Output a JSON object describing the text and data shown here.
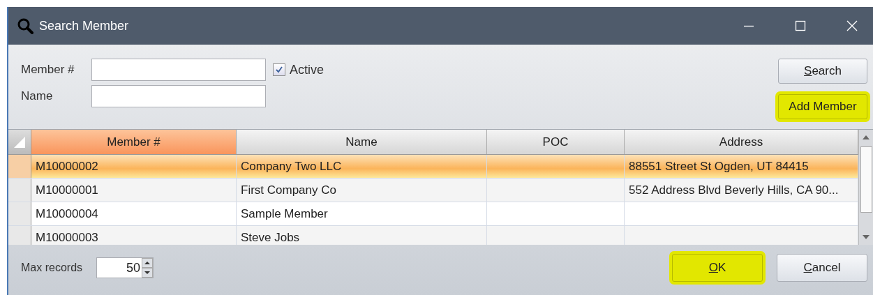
{
  "window": {
    "title": "Search Member"
  },
  "filters": {
    "member_label": "Member #",
    "name_label": "Name",
    "active": {
      "label": "Active",
      "checked": true
    }
  },
  "side_buttons": [
    {
      "label": "Search",
      "mnemonic": true,
      "highlighted": false
    },
    {
      "label": "Add Member",
      "mnemonic": false,
      "highlighted": true
    }
  ],
  "table": {
    "columns": [
      {
        "label": "Member #",
        "sorted": true
      },
      {
        "label": "Name",
        "sorted": false
      },
      {
        "label": "POC",
        "sorted": false
      },
      {
        "label": "Address",
        "sorted": false
      }
    ],
    "rows": [
      {
        "cells": [
          "M10000002",
          "Company Two LLC",
          "",
          "88551 Street St Ogden, UT 84415"
        ],
        "selected": true
      },
      {
        "cells": [
          "M10000001",
          "First Company Co",
          "",
          "552 Address Blvd Beverly Hills, CA 90..."
        ],
        "selected": false
      },
      {
        "cells": [
          "M10000004",
          "Sample Member",
          "",
          ""
        ],
        "selected": false
      },
      {
        "cells": [
          "M10000003",
          "Steve Jobs",
          "",
          ""
        ],
        "selected": false
      }
    ]
  },
  "footer": {
    "max_label": "Max records",
    "max_value": "50"
  },
  "footer_buttons": [
    {
      "label": "OK",
      "mnemonic": true,
      "highlighted": true
    },
    {
      "label": "Cancel",
      "mnemonic": true,
      "highlighted": false
    }
  ]
}
